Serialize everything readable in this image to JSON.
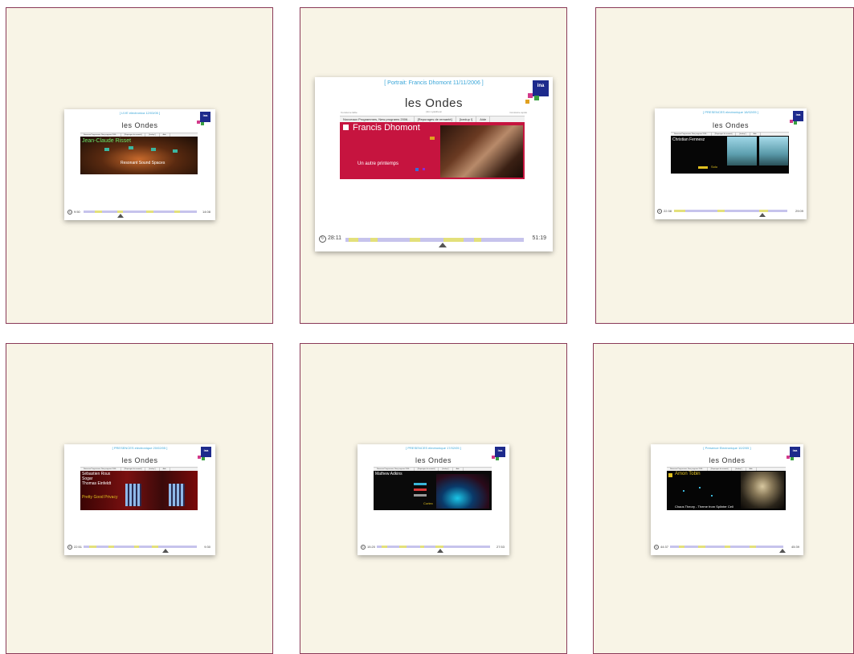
{
  "slides": [
    {
      "caption": "[ LIVE electronica 12/03/05 ]",
      "brand": "les Ondes",
      "nav": [
        "Nouveaux Programmes, New programs 2006...",
        "[Repurages de remanté]",
        "[Icedup !]",
        "Aide"
      ],
      "artist": "Jean-Claude Risset",
      "title": "Resonant Sound Spaces",
      "time_left": "9:50",
      "time_right": "14:08"
    },
    {
      "caption": "[ Portrait: Francis Dhomont 11/11/2006 ]",
      "brand": "les Ondes",
      "subtitle": "(nlm vyastheon",
      "top_left": "Consiume lable",
      "top_right": "Consiume apulé",
      "nav": [
        "Nouveaux Programmes, New programs 2006...",
        "[Repurages de remanté]",
        "[Icedup !]",
        "Aide"
      ],
      "artist": "Francis Dhomont",
      "title": "Un autre printemps",
      "time_left": "28:11",
      "time_right": "51:19"
    },
    {
      "caption": "[ PRESENCES electronique 18/02/05 ]",
      "brand": "les Ondes",
      "nav": [
        "Nouveaux Programmes, New programs 2006...",
        "[Repurages de remanté]",
        "[Icedup !]",
        "Aide"
      ],
      "artist": "Christian Fennesz",
      "title": "Solo",
      "time_left": "22:38",
      "time_right": "29:09"
    },
    {
      "caption": "[ PRESENCES electronique 20/02/05 ]",
      "brand": "les Ondes",
      "nav": [
        "Nouveaux Programmes, New programs 2006...",
        "[Repurages de remanté]",
        "[Icedup !]",
        "Aide"
      ],
      "artists": [
        "Sébastien Roux",
        "Sogar",
        "Thomas Einfeldt"
      ],
      "title": "Pretty Good Privacy",
      "time_left": "22:51",
      "time_right": "9:30"
    },
    {
      "caption": "[ PRESENCES electronique 17/02/05 ]",
      "brand": "les Ondes",
      "nav": [
        "Nouveaux Programmes, New programs 2006...",
        "[Repurages de remanté]",
        "[Icedup !]",
        "Aide"
      ],
      "artist": "Mathew Adkins",
      "title": "Cortex",
      "time_left": "15:20",
      "time_right": "27:53"
    },
    {
      "caption": "[ Presence Electronique 10/2/05 ]",
      "brand": "les Ondes",
      "nav": [
        "Nouveaux Programmes, New programs 2006...",
        "[Repurages de remanté]",
        "[Icedup !]",
        "Aide"
      ],
      "artist": "Amon Tobin",
      "title": "Chaos Theory - Theme from Splinter Cell",
      "time_left": "44:37",
      "time_right": "45:39"
    }
  ],
  "logo_text": "ina",
  "colors": {
    "panel_bg": "#f8f4e6",
    "panel_border": "#8a3a58",
    "caption": "#3aa6d8",
    "progress": "#c6c3ec",
    "progress_hi": "#e3e07a",
    "dhomont_red": "#c6143f"
  }
}
